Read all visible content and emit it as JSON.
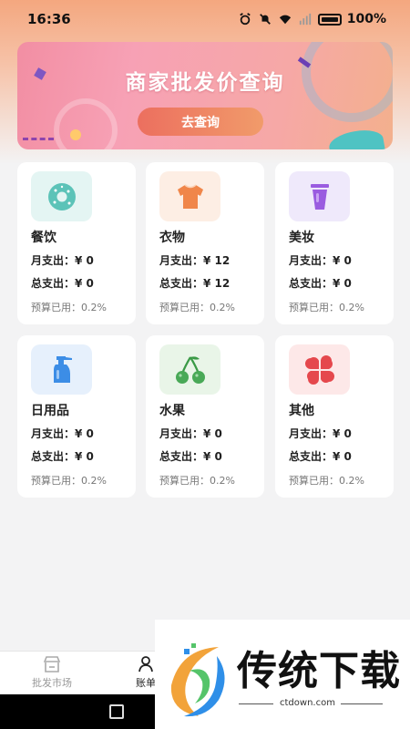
{
  "status": {
    "time": "16:36",
    "battery": "100%"
  },
  "banner": {
    "title": "商家批发价查询",
    "button": "去查询"
  },
  "categories": [
    {
      "name": "餐饮",
      "month": "月支出：¥ 0",
      "total": "总支出：¥ 0",
      "budget": "预算已用：0.2%",
      "icon": "donut-icon",
      "icon_bg": "#e4f5f3"
    },
    {
      "name": "衣物",
      "month": "月支出：¥ 12",
      "total": "总支出：¥ 12",
      "budget": "预算已用：0.2%",
      "icon": "tshirt-icon",
      "icon_bg": "#fdeee4"
    },
    {
      "name": "美妆",
      "month": "月支出：¥ 0",
      "total": "总支出：¥ 0",
      "budget": "预算已用：0.2%",
      "icon": "cosmetic-cup-icon",
      "icon_bg": "#efe9fb"
    },
    {
      "name": "日用品",
      "month": "月支出：¥ 0",
      "total": "总支出：¥ 0",
      "budget": "预算已用：0.2%",
      "icon": "spray-bottle-icon",
      "icon_bg": "#e6f0fc"
    },
    {
      "name": "水果",
      "month": "月支出：¥ 0",
      "total": "总支出：¥ 0",
      "budget": "预算已用：0.2%",
      "icon": "cherry-icon",
      "icon_bg": "#e9f5e8"
    },
    {
      "name": "其他",
      "month": "月支出：¥ 0",
      "total": "总支出：¥ 0",
      "budget": "预算已用：0.2%",
      "icon": "four-petal-icon",
      "icon_bg": "#fde8e8"
    }
  ],
  "nav": {
    "market": "批发市场",
    "bill": "账单"
  },
  "watermark": {
    "brand": "传统下载",
    "url": "ctdown.com"
  },
  "colors": {
    "accent": "#ec6f5f",
    "banner_pink": "#f28ea3"
  }
}
